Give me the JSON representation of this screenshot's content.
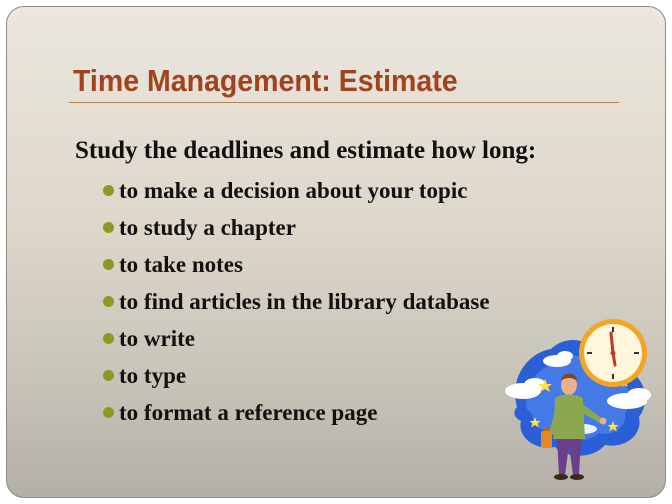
{
  "slide": {
    "title": "Time Management: Estimate",
    "lead": "Study the deadlines and estimate how long:",
    "bullets": [
      "to make a decision about your topic",
      "to study a chapter",
      "to take notes",
      "to find articles in the library database",
      "to write",
      "to type",
      "to format a reference page"
    ]
  },
  "colors": {
    "title": "#a2431f",
    "bullet": "#8b9a22",
    "text": "#111111"
  },
  "clipart": {
    "icon": "person-looking-at-clock-icon"
  }
}
